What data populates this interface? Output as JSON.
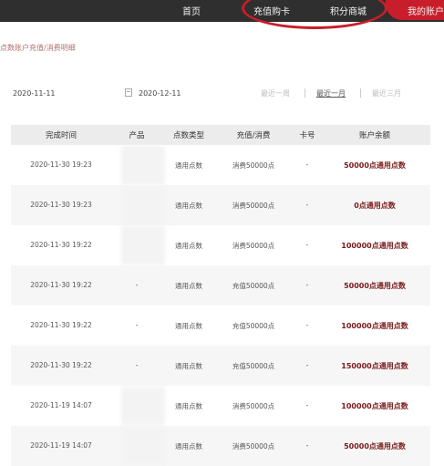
{
  "nav": {
    "items": [
      {
        "label": "首页"
      },
      {
        "label": "充值购卡"
      },
      {
        "label": "积分商城"
      },
      {
        "label": "我的账户"
      }
    ]
  },
  "breadcrumb": "点数账户充值/消费明细",
  "filter": {
    "start_date": "2020-11-11",
    "end_date": "2020-12-11",
    "ranges": [
      {
        "label": "最近一周"
      },
      {
        "label": "最近一月"
      },
      {
        "label": "最近三月"
      }
    ]
  },
  "table": {
    "columns": [
      "完成时间",
      "产品",
      "点数类型",
      "充值/消费",
      "卡号",
      "账户余额"
    ],
    "rows": [
      {
        "time": "2020-11-30 19:23",
        "product": "",
        "type": "通用点数",
        "amount": "消费50000点",
        "card": "-",
        "balance": "50000点通用点数"
      },
      {
        "time": "2020-11-30 19:23",
        "product": "",
        "type": "通用点数",
        "amount": "消费50000点",
        "card": "-",
        "balance": "0点通用点数"
      },
      {
        "time": "2020-11-30 19:22",
        "product": "",
        "type": "通用点数",
        "amount": "消费50000点",
        "card": "-",
        "balance": "100000点通用点数"
      },
      {
        "time": "2020-11-30 19:22",
        "product": "-",
        "type": "通用点数",
        "amount": "充值50000点",
        "card": "-",
        "balance": "50000点通用点数"
      },
      {
        "time": "2020-11-30 19:22",
        "product": "-",
        "type": "通用点数",
        "amount": "充值50000点",
        "card": "-",
        "balance": "100000点通用点数"
      },
      {
        "time": "2020-11-30 19:22",
        "product": "-",
        "type": "通用点数",
        "amount": "充值50000点",
        "card": "-",
        "balance": "150000点通用点数"
      },
      {
        "time": "2020-11-19 14:07",
        "product": "",
        "type": "通用点数",
        "amount": "消费50000点",
        "card": "-",
        "balance": "100000点通用点数"
      },
      {
        "time": "2020-11-19 14:07",
        "product": "",
        "type": "通用点数",
        "amount": "消费50000点",
        "card": "-",
        "balance": "50000点通用点数"
      }
    ]
  },
  "colors": {
    "nav_bg": "#2f2f2f",
    "accent": "#c81e2b",
    "balance": "#7a1a1a"
  }
}
